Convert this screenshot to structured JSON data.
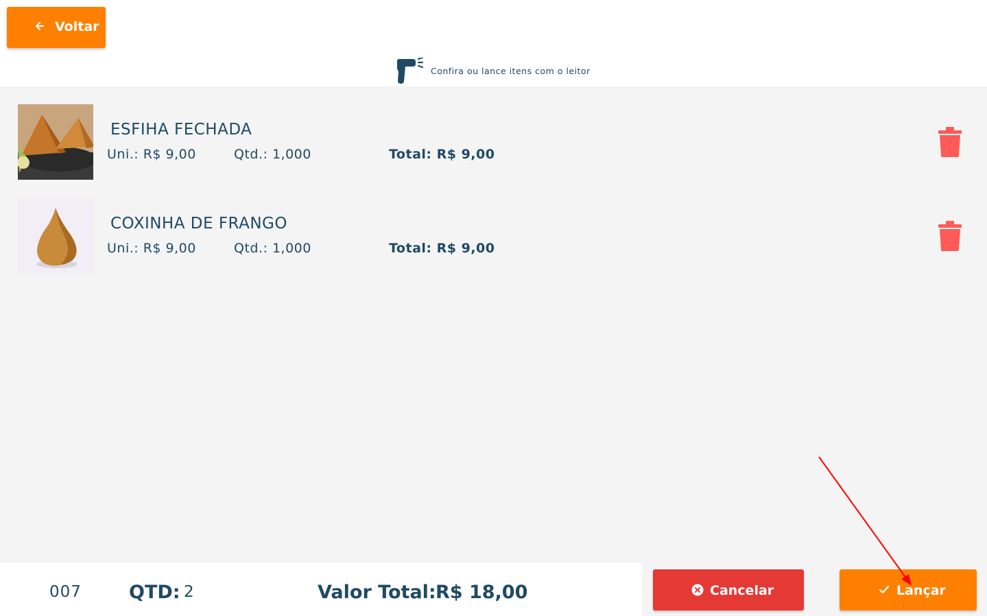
{
  "header": {
    "back_label": "Voltar",
    "scanner_text": "Confira ou lance itens com o leitor"
  },
  "items": [
    {
      "name": "ESFIHA FECHADA",
      "unit": "Uni.: R$ 9,00",
      "qty": "Qtd.:  1,000",
      "total": "Total: R$ 9,00",
      "image": "esfiha-photo"
    },
    {
      "name": "COXINHA DE FRANGO",
      "unit": "Uni.: R$ 9,00",
      "qty": "Qtd.:  1,000",
      "total": "Total: R$ 9,00",
      "image": "coxinha-photo"
    }
  ],
  "footer": {
    "code": "007",
    "qtd_label": "QTD:",
    "qtd_value": "2",
    "valor_label": "Valor Total:",
    "valor_value": "R$ 18,00"
  },
  "actions": {
    "cancel_label": "Cancelar",
    "lancar_label": "Lançar"
  },
  "colors": {
    "primary_text": "#1f4a63",
    "accent_orange": "#ff8000",
    "danger_red": "#e53935",
    "trash_red": "#ff5a57",
    "background": "#f4f4f4"
  }
}
